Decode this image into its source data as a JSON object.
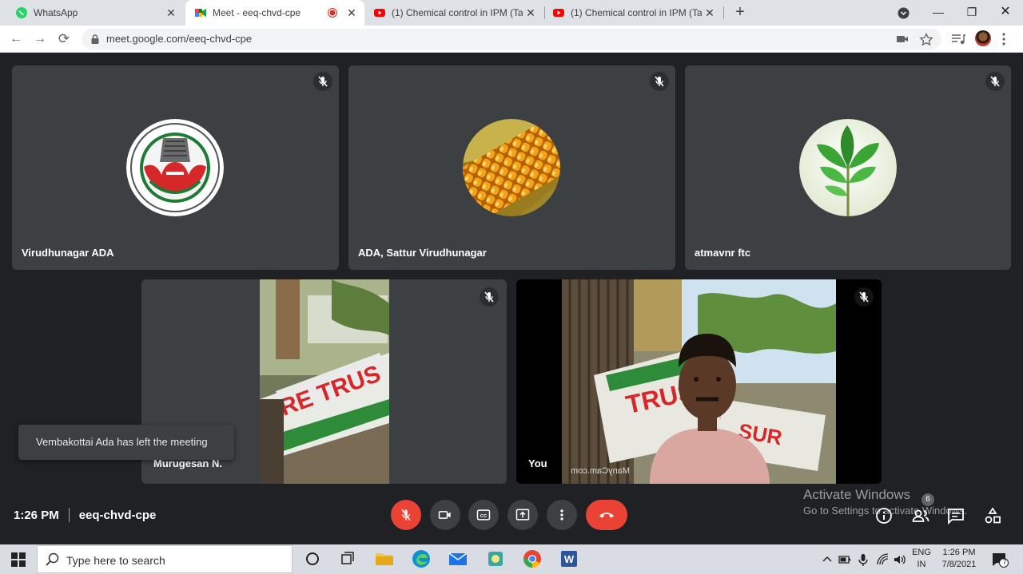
{
  "browser": {
    "tabs": [
      {
        "title": "WhatsApp",
        "icon": "whatsapp-icon"
      },
      {
        "title": "Meet - eeq-chvd-cpe",
        "icon": "meet-icon",
        "recording": true
      },
      {
        "title": "(1) Chemical control in IPM (Tam",
        "icon": "youtube-icon"
      },
      {
        "title": "(1) Chemical control in IPM (Tam",
        "icon": "youtube-icon"
      }
    ],
    "url": "meet.google.com/eeq-chvd-cpe"
  },
  "meet": {
    "participants": [
      {
        "name": "Virudhunagar ADA",
        "avatar": "university-emblem",
        "muted": true
      },
      {
        "name": "ADA, Sattur Virudhunagar",
        "avatar": "corn-image",
        "muted": true
      },
      {
        "name": "atmavnr ftc",
        "avatar": "plant-leaf-image",
        "muted": true
      },
      {
        "name": "Murugesan N.",
        "avatar": "camera-video",
        "muted": true
      },
      {
        "name": "You",
        "avatar": "camera-video",
        "muted": true
      }
    ],
    "notification": "Vembakottai Ada has left the meeting",
    "time": "1:26 PM",
    "meeting_code": "eeq-chvd-cpe",
    "watermark": "ManyCam.com",
    "participant_count": "6",
    "colors": {
      "background": "#202124",
      "tile": "#3c4043",
      "danger": "#ea4335"
    }
  },
  "windows": {
    "activate_title": "Activate Windows",
    "activate_subtitle": "Go to Settings to activate Windows.",
    "search_placeholder": "Type here to search",
    "language": "ENG",
    "region": "IN",
    "clock_time": "1:26 PM",
    "clock_date": "7/8/2021",
    "notif_count": "7"
  }
}
